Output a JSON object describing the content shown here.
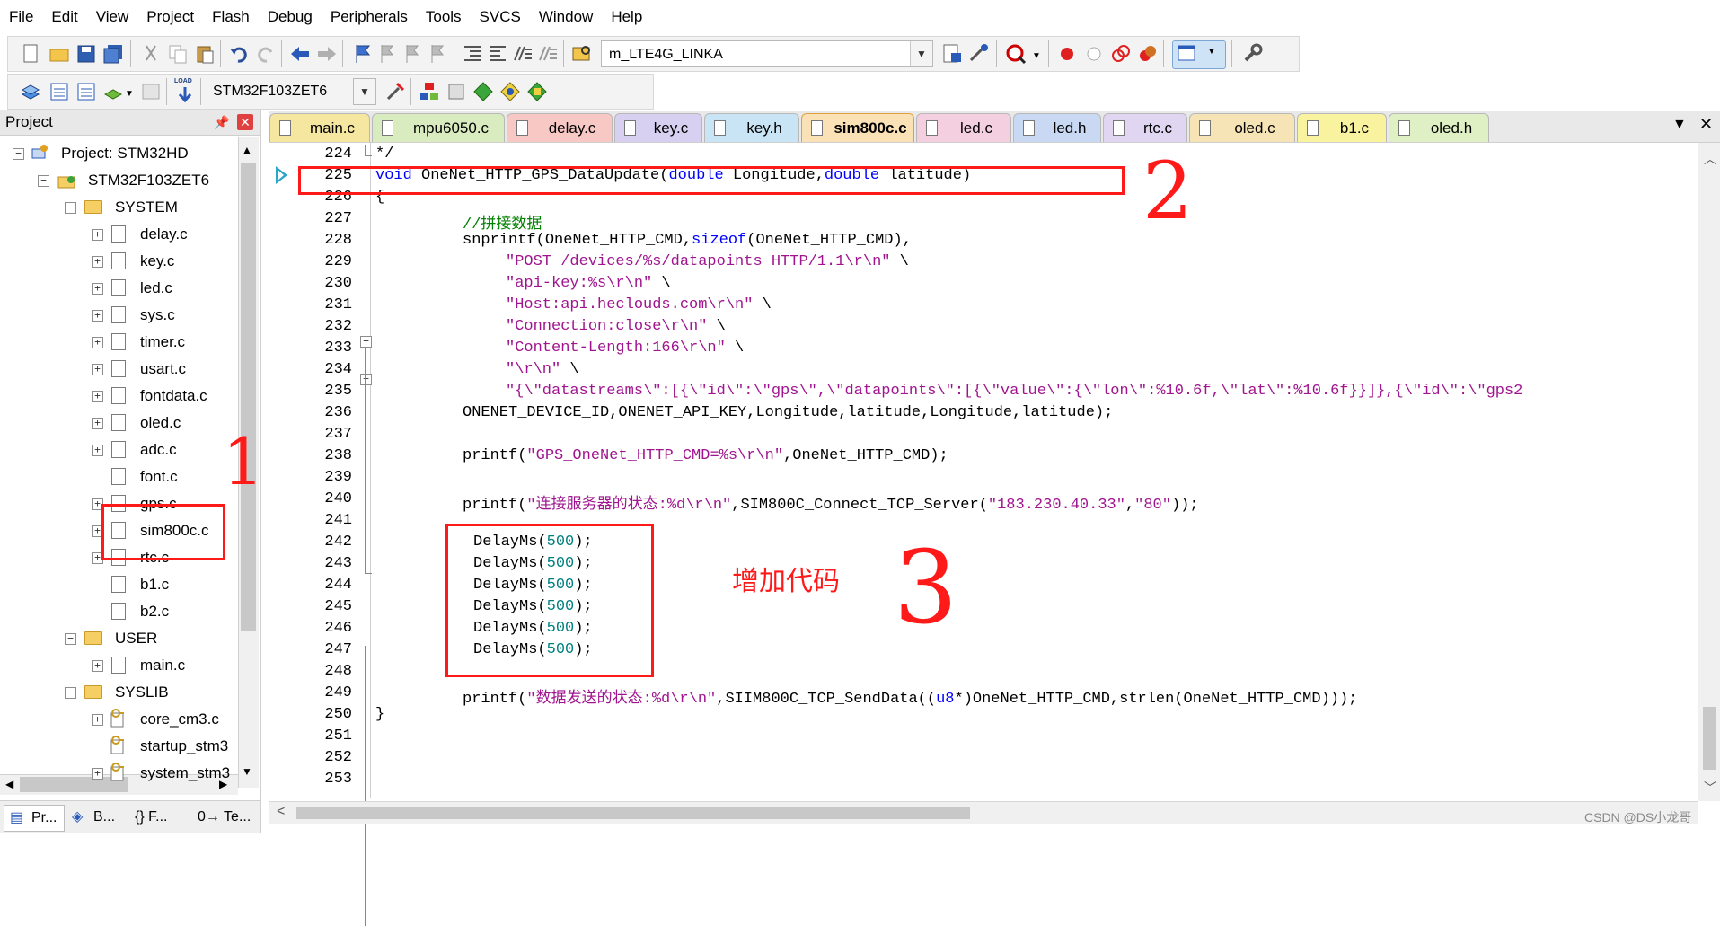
{
  "menubar": [
    "File",
    "Edit",
    "View",
    "Project",
    "Flash",
    "Debug",
    "Peripherals",
    "Tools",
    "SVCS",
    "Window",
    "Help"
  ],
  "toolbar": {
    "target_combo": "m_LTE4G_LINKA",
    "device_combo": "STM32F103ZET6",
    "load_label": "LOAD"
  },
  "project": {
    "header": "Project",
    "root": "Project: STM32HD",
    "target": "STM32F103ZET6",
    "groups": [
      {
        "name": "SYSTEM",
        "files": [
          "delay.c",
          "key.c",
          "led.c",
          "sys.c",
          "timer.c",
          "usart.c",
          "fontdata.c",
          "oled.c",
          "adc.c",
          "font.c",
          "gps.c",
          "sim800c.c",
          "rtc.c",
          "b1.c",
          "b2.c"
        ]
      },
      {
        "name": "USER",
        "files": [
          "main.c"
        ]
      },
      {
        "name": "SYSLIB",
        "files": [
          "core_cm3.c",
          "startup_stm3",
          "system_stm3"
        ]
      }
    ],
    "bottom_tabs": [
      "Pr...",
      "B...",
      "{} F...",
      "0→ Te..."
    ]
  },
  "tabs": [
    "main.c",
    "mpu6050.c",
    "delay.c",
    "key.c",
    "key.h",
    "sim800c.c",
    "led.c",
    "led.h",
    "rtc.c",
    "oled.c",
    "b1.c",
    "oled.h"
  ],
  "active_tab": "sim800c.c",
  "editor": {
    "line_numbers": [
      "224",
      "225",
      "226",
      "227",
      "228",
      "229",
      "230",
      "231",
      "232",
      "233",
      "234",
      "235",
      "236",
      "237",
      "238",
      "239",
      "240",
      "241",
      "242",
      "243",
      "244",
      "245",
      "246",
      "247",
      "248",
      "249",
      "250",
      "251",
      "252",
      "253"
    ],
    "line224": "*/",
    "line225": {
      "kw1": "void",
      "name": " OneNet_HTTP_GPS_DataUpdate(",
      "kw2": "double",
      "p1": " Longitude,",
      "kw3": "double",
      "p2": " latitude)"
    },
    "line226": "{",
    "line227": "//拼接数据",
    "line228": {
      "a": "snprintf(OneNet_HTTP_CMD,",
      "kw": "sizeof",
      "b": "(OneNet_HTTP_CMD),"
    },
    "line229": {
      "s": "\"POST /devices/%s/datapoints HTTP/1.1\\r\\n\"",
      "t": " \\"
    },
    "line230": {
      "s": "\"api-key:%s\\r\\n\"",
      "t": " \\"
    },
    "line231": {
      "s": "\"Host:api.heclouds.com\\r\\n\"",
      "t": " \\"
    },
    "line232": {
      "s": "\"Connection:close\\r\\n\"",
      "t": " \\"
    },
    "line233": {
      "s": "\"Content-Length:166\\r\\n\"",
      "t": " \\"
    },
    "line234": {
      "s": "\"\\r\\n\"",
      "t": " \\"
    },
    "line235": "\"{\\\"datastreams\\\":[{\\\"id\\\":\\\"gps\\\",\\\"datapoints\\\":[{\\\"value\\\":{\\\"lon\\\":%10.6f,\\\"lat\\\":%10.6f}}]},{\\\"id\\\":\\\"gps2",
    "line236": "ONENET_DEVICE_ID,ONENET_API_KEY,Longitude,latitude,Longitude,latitude);",
    "line238": {
      "a": "printf(",
      "s": "\"GPS_OneNet_HTTP_CMD=%s\\r\\n\"",
      "b": ",OneNet_HTTP_CMD);"
    },
    "line240": {
      "a": "printf(",
      "s": "\"连接服务器的状态:%d\\r\\n\"",
      "b": ",SIM800C_Connect_TCP_Server(",
      "s2": "\"183.230.40.33\"",
      "c": ",",
      "s3": "\"80\"",
      "d": "));"
    },
    "delay": {
      "fn": "DelayMs(",
      "arg": "500",
      "end": ");"
    },
    "line249": {
      "a": "printf(",
      "s": "\"数据发送的状态:%d\\r\\n\"",
      "b": ",SIIM800C_TCP_SendData((",
      "kw": "u8",
      "c": "*)OneNet_HTTP_CMD,strlen(OneNet_HTTP_CMD)));"
    },
    "line250": "}"
  },
  "annotations": {
    "one": "1",
    "two": "2",
    "three": "3",
    "added_code": "增加代码"
  },
  "watermark": "CSDN @DS小龙哥",
  "colors": {
    "keyword": "#0000ff",
    "string": "#a0158f",
    "comment": "#008000",
    "number": "#008080",
    "annotation": "#ff1a1a"
  }
}
